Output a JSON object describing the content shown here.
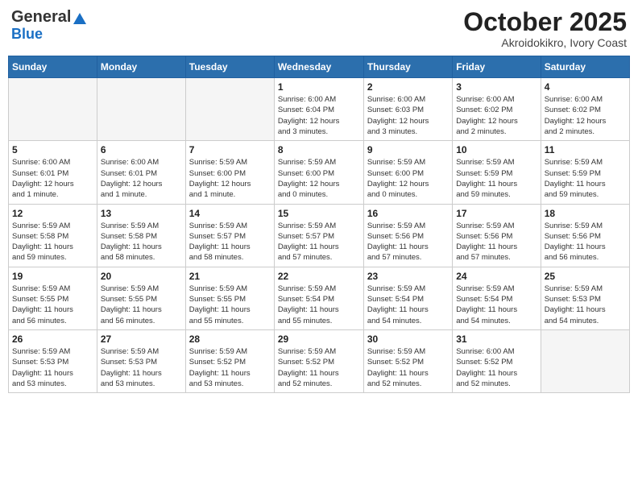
{
  "header": {
    "logo_general": "General",
    "logo_blue": "Blue",
    "month_year": "October 2025",
    "location": "Akroidokikro, Ivory Coast"
  },
  "weekdays": [
    "Sunday",
    "Monday",
    "Tuesday",
    "Wednesday",
    "Thursday",
    "Friday",
    "Saturday"
  ],
  "weeks": [
    [
      {
        "day": "",
        "info": ""
      },
      {
        "day": "",
        "info": ""
      },
      {
        "day": "",
        "info": ""
      },
      {
        "day": "1",
        "info": "Sunrise: 6:00 AM\nSunset: 6:04 PM\nDaylight: 12 hours\nand 3 minutes."
      },
      {
        "day": "2",
        "info": "Sunrise: 6:00 AM\nSunset: 6:03 PM\nDaylight: 12 hours\nand 3 minutes."
      },
      {
        "day": "3",
        "info": "Sunrise: 6:00 AM\nSunset: 6:02 PM\nDaylight: 12 hours\nand 2 minutes."
      },
      {
        "day": "4",
        "info": "Sunrise: 6:00 AM\nSunset: 6:02 PM\nDaylight: 12 hours\nand 2 minutes."
      }
    ],
    [
      {
        "day": "5",
        "info": "Sunrise: 6:00 AM\nSunset: 6:01 PM\nDaylight: 12 hours\nand 1 minute."
      },
      {
        "day": "6",
        "info": "Sunrise: 6:00 AM\nSunset: 6:01 PM\nDaylight: 12 hours\nand 1 minute."
      },
      {
        "day": "7",
        "info": "Sunrise: 5:59 AM\nSunset: 6:00 PM\nDaylight: 12 hours\nand 1 minute."
      },
      {
        "day": "8",
        "info": "Sunrise: 5:59 AM\nSunset: 6:00 PM\nDaylight: 12 hours\nand 0 minutes."
      },
      {
        "day": "9",
        "info": "Sunrise: 5:59 AM\nSunset: 6:00 PM\nDaylight: 12 hours\nand 0 minutes."
      },
      {
        "day": "10",
        "info": "Sunrise: 5:59 AM\nSunset: 5:59 PM\nDaylight: 11 hours\nand 59 minutes."
      },
      {
        "day": "11",
        "info": "Sunrise: 5:59 AM\nSunset: 5:59 PM\nDaylight: 11 hours\nand 59 minutes."
      }
    ],
    [
      {
        "day": "12",
        "info": "Sunrise: 5:59 AM\nSunset: 5:58 PM\nDaylight: 11 hours\nand 59 minutes."
      },
      {
        "day": "13",
        "info": "Sunrise: 5:59 AM\nSunset: 5:58 PM\nDaylight: 11 hours\nand 58 minutes."
      },
      {
        "day": "14",
        "info": "Sunrise: 5:59 AM\nSunset: 5:57 PM\nDaylight: 11 hours\nand 58 minutes."
      },
      {
        "day": "15",
        "info": "Sunrise: 5:59 AM\nSunset: 5:57 PM\nDaylight: 11 hours\nand 57 minutes."
      },
      {
        "day": "16",
        "info": "Sunrise: 5:59 AM\nSunset: 5:56 PM\nDaylight: 11 hours\nand 57 minutes."
      },
      {
        "day": "17",
        "info": "Sunrise: 5:59 AM\nSunset: 5:56 PM\nDaylight: 11 hours\nand 57 minutes."
      },
      {
        "day": "18",
        "info": "Sunrise: 5:59 AM\nSunset: 5:56 PM\nDaylight: 11 hours\nand 56 minutes."
      }
    ],
    [
      {
        "day": "19",
        "info": "Sunrise: 5:59 AM\nSunset: 5:55 PM\nDaylight: 11 hours\nand 56 minutes."
      },
      {
        "day": "20",
        "info": "Sunrise: 5:59 AM\nSunset: 5:55 PM\nDaylight: 11 hours\nand 56 minutes."
      },
      {
        "day": "21",
        "info": "Sunrise: 5:59 AM\nSunset: 5:55 PM\nDaylight: 11 hours\nand 55 minutes."
      },
      {
        "day": "22",
        "info": "Sunrise: 5:59 AM\nSunset: 5:54 PM\nDaylight: 11 hours\nand 55 minutes."
      },
      {
        "day": "23",
        "info": "Sunrise: 5:59 AM\nSunset: 5:54 PM\nDaylight: 11 hours\nand 54 minutes."
      },
      {
        "day": "24",
        "info": "Sunrise: 5:59 AM\nSunset: 5:54 PM\nDaylight: 11 hours\nand 54 minutes."
      },
      {
        "day": "25",
        "info": "Sunrise: 5:59 AM\nSunset: 5:53 PM\nDaylight: 11 hours\nand 54 minutes."
      }
    ],
    [
      {
        "day": "26",
        "info": "Sunrise: 5:59 AM\nSunset: 5:53 PM\nDaylight: 11 hours\nand 53 minutes."
      },
      {
        "day": "27",
        "info": "Sunrise: 5:59 AM\nSunset: 5:53 PM\nDaylight: 11 hours\nand 53 minutes."
      },
      {
        "day": "28",
        "info": "Sunrise: 5:59 AM\nSunset: 5:52 PM\nDaylight: 11 hours\nand 53 minutes."
      },
      {
        "day": "29",
        "info": "Sunrise: 5:59 AM\nSunset: 5:52 PM\nDaylight: 11 hours\nand 52 minutes."
      },
      {
        "day": "30",
        "info": "Sunrise: 5:59 AM\nSunset: 5:52 PM\nDaylight: 11 hours\nand 52 minutes."
      },
      {
        "day": "31",
        "info": "Sunrise: 6:00 AM\nSunset: 5:52 PM\nDaylight: 11 hours\nand 52 minutes."
      },
      {
        "day": "",
        "info": ""
      }
    ]
  ]
}
